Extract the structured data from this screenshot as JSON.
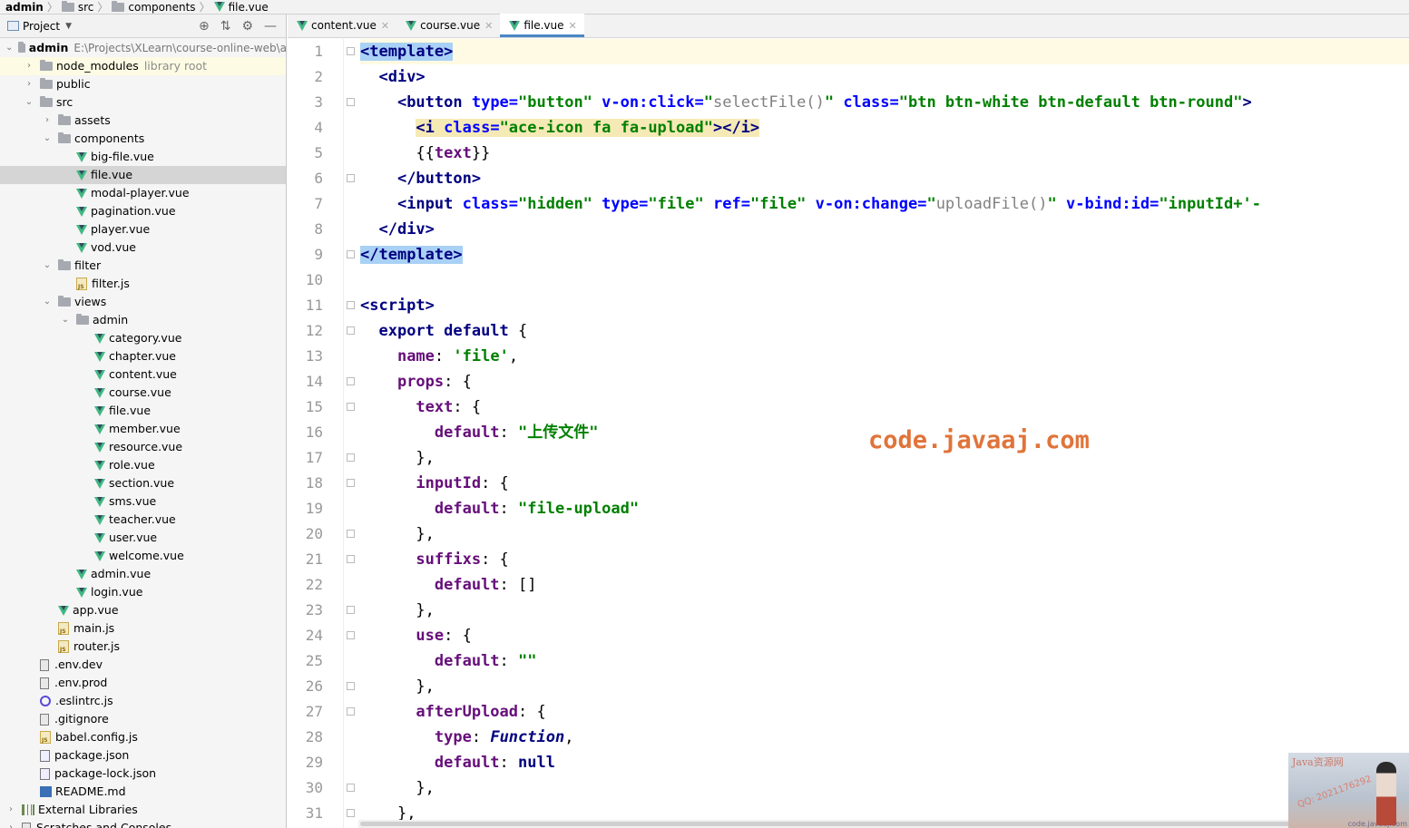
{
  "breadcrumb": [
    "admin",
    "src",
    "components",
    "file.vue"
  ],
  "project_panel": {
    "title": "Project",
    "tree": [
      {
        "label": "admin",
        "path": "E:\\Projects\\XLearn\\course-online-web\\a",
        "type": "folder",
        "depth": 0,
        "open": true,
        "bold": true
      },
      {
        "label": "node_modules",
        "extra": "library root",
        "type": "folder",
        "depth": 1,
        "open": false,
        "highlight": true
      },
      {
        "label": "public",
        "type": "folder",
        "depth": 1,
        "open": false
      },
      {
        "label": "src",
        "type": "folder",
        "depth": 1,
        "open": true
      },
      {
        "label": "assets",
        "type": "folder",
        "depth": 2,
        "open": false
      },
      {
        "label": "components",
        "type": "folder",
        "depth": 2,
        "open": true
      },
      {
        "label": "big-file.vue",
        "type": "vue",
        "depth": 3
      },
      {
        "label": "file.vue",
        "type": "vue",
        "depth": 3,
        "selected": true
      },
      {
        "label": "modal-player.vue",
        "type": "vue",
        "depth": 3
      },
      {
        "label": "pagination.vue",
        "type": "vue",
        "depth": 3
      },
      {
        "label": "player.vue",
        "type": "vue",
        "depth": 3
      },
      {
        "label": "vod.vue",
        "type": "vue",
        "depth": 3
      },
      {
        "label": "filter",
        "type": "folder",
        "depth": 2,
        "open": true
      },
      {
        "label": "filter.js",
        "type": "js",
        "depth": 3
      },
      {
        "label": "views",
        "type": "folder",
        "depth": 2,
        "open": true
      },
      {
        "label": "admin",
        "type": "folder",
        "depth": 3,
        "open": true
      },
      {
        "label": "category.vue",
        "type": "vue",
        "depth": 4
      },
      {
        "label": "chapter.vue",
        "type": "vue",
        "depth": 4
      },
      {
        "label": "content.vue",
        "type": "vue",
        "depth": 4
      },
      {
        "label": "course.vue",
        "type": "vue",
        "depth": 4
      },
      {
        "label": "file.vue",
        "type": "vue",
        "depth": 4
      },
      {
        "label": "member.vue",
        "type": "vue",
        "depth": 4
      },
      {
        "label": "resource.vue",
        "type": "vue",
        "depth": 4
      },
      {
        "label": "role.vue",
        "type": "vue",
        "depth": 4
      },
      {
        "label": "section.vue",
        "type": "vue",
        "depth": 4
      },
      {
        "label": "sms.vue",
        "type": "vue",
        "depth": 4
      },
      {
        "label": "teacher.vue",
        "type": "vue",
        "depth": 4
      },
      {
        "label": "user.vue",
        "type": "vue",
        "depth": 4
      },
      {
        "label": "welcome.vue",
        "type": "vue",
        "depth": 4
      },
      {
        "label": "admin.vue",
        "type": "vue",
        "depth": 3
      },
      {
        "label": "login.vue",
        "type": "vue",
        "depth": 3
      },
      {
        "label": "app.vue",
        "type": "vue",
        "depth": 2
      },
      {
        "label": "main.js",
        "type": "js",
        "depth": 2
      },
      {
        "label": "router.js",
        "type": "js",
        "depth": 2
      },
      {
        "label": ".env.dev",
        "type": "file",
        "depth": 1
      },
      {
        "label": ".env.prod",
        "type": "file",
        "depth": 1
      },
      {
        "label": ".eslintrc.js",
        "type": "eslint",
        "depth": 1
      },
      {
        "label": ".gitignore",
        "type": "file",
        "depth": 1
      },
      {
        "label": "babel.config.js",
        "type": "js",
        "depth": 1
      },
      {
        "label": "package.json",
        "type": "json",
        "depth": 1
      },
      {
        "label": "package-lock.json",
        "type": "json",
        "depth": 1
      },
      {
        "label": "README.md",
        "type": "md",
        "depth": 1
      },
      {
        "label": "External Libraries",
        "type": "lib",
        "depth": 0,
        "open": false
      },
      {
        "label": "Scratches and Consoles",
        "type": "scratch",
        "depth": 0,
        "open": false
      }
    ]
  },
  "tabs": [
    {
      "label": "content.vue",
      "active": false
    },
    {
      "label": "course.vue",
      "active": false
    },
    {
      "label": "file.vue",
      "active": true
    }
  ],
  "code_lines": [
    [
      [
        "<",
        "tag tpl-hl"
      ],
      [
        "template",
        "tag tpl-hl"
      ],
      [
        ">",
        "tag tpl-hl"
      ]
    ],
    [
      [
        "  ",
        ""
      ],
      [
        "<div>",
        "tag"
      ]
    ],
    [
      [
        "    ",
        ""
      ],
      [
        "<button ",
        "tag"
      ],
      [
        "type=",
        "attr"
      ],
      [
        "\"button\"",
        "str"
      ],
      [
        " v-on:click=",
        "attr"
      ],
      [
        "\"",
        "str"
      ],
      [
        "selectFile()",
        "fn"
      ],
      [
        "\"",
        "str"
      ],
      [
        " class=",
        "attr"
      ],
      [
        "\"btn btn-white btn-default btn-round\"",
        "str"
      ],
      [
        ">",
        "tag"
      ]
    ],
    [
      [
        "      ",
        ""
      ],
      [
        "<i ",
        "tag i-hl"
      ],
      [
        "class=",
        "attr i-hl"
      ],
      [
        "\"ace-icon fa fa-upload\"",
        "str i-hl"
      ],
      [
        "></i>",
        "tag i-hl"
      ]
    ],
    [
      [
        "      ",
        ""
      ],
      [
        "{{",
        ""
      ],
      [
        "text",
        "prop"
      ],
      [
        "}}",
        ""
      ]
    ],
    [
      [
        "    ",
        ""
      ],
      [
        "</button>",
        "tag"
      ]
    ],
    [
      [
        "    ",
        ""
      ],
      [
        "<input ",
        "tag"
      ],
      [
        "class=",
        "attr"
      ],
      [
        "\"hidden\"",
        "str"
      ],
      [
        " type=",
        "attr"
      ],
      [
        "\"file\"",
        "str"
      ],
      [
        " ref=",
        "attr"
      ],
      [
        "\"file\"",
        "str"
      ],
      [
        " v-on:change=",
        "attr"
      ],
      [
        "\"",
        "str"
      ],
      [
        "uploadFile()",
        "fn"
      ],
      [
        "\"",
        "str"
      ],
      [
        " v-bind:id=",
        "attr"
      ],
      [
        "\"inputId+'-",
        "str"
      ]
    ],
    [
      [
        "  ",
        ""
      ],
      [
        "</div>",
        "tag"
      ]
    ],
    [
      [
        "</",
        "tag tpl-hl"
      ],
      [
        "template",
        "tag tpl-hl"
      ],
      [
        ">",
        "tag tpl-hl"
      ]
    ],
    [
      [
        "",
        ""
      ]
    ],
    [
      [
        "<script>",
        "tag"
      ]
    ],
    [
      [
        "  ",
        ""
      ],
      [
        "export default",
        "kw"
      ],
      [
        " {",
        ""
      ]
    ],
    [
      [
        "    ",
        ""
      ],
      [
        "name",
        "prop"
      ],
      [
        ": ",
        ""
      ],
      [
        "'file'",
        "str"
      ],
      [
        ",",
        ""
      ]
    ],
    [
      [
        "    ",
        ""
      ],
      [
        "props",
        "prop"
      ],
      [
        ": {",
        ""
      ]
    ],
    [
      [
        "      ",
        ""
      ],
      [
        "text",
        "prop"
      ],
      [
        ": {",
        ""
      ]
    ],
    [
      [
        "        ",
        ""
      ],
      [
        "default",
        "prop"
      ],
      [
        ": ",
        ""
      ],
      [
        "\"上传文件\"",
        "str"
      ]
    ],
    [
      [
        "      ",
        ""
      ],
      [
        "},",
        ""
      ]
    ],
    [
      [
        "      ",
        ""
      ],
      [
        "inputId",
        "prop"
      ],
      [
        ": {",
        ""
      ]
    ],
    [
      [
        "        ",
        ""
      ],
      [
        "default",
        "prop"
      ],
      [
        ": ",
        ""
      ],
      [
        "\"file-upload\"",
        "str"
      ]
    ],
    [
      [
        "      ",
        ""
      ],
      [
        "},",
        ""
      ]
    ],
    [
      [
        "      ",
        ""
      ],
      [
        "suffixs",
        "prop"
      ],
      [
        ": {",
        ""
      ]
    ],
    [
      [
        "        ",
        ""
      ],
      [
        "default",
        "prop"
      ],
      [
        ": []",
        ""
      ]
    ],
    [
      [
        "      ",
        ""
      ],
      [
        "},",
        ""
      ]
    ],
    [
      [
        "      ",
        ""
      ],
      [
        "use",
        "prop"
      ],
      [
        ": {",
        ""
      ]
    ],
    [
      [
        "        ",
        ""
      ],
      [
        "default",
        "prop"
      ],
      [
        ": ",
        ""
      ],
      [
        "\"\"",
        "str"
      ]
    ],
    [
      [
        "      ",
        ""
      ],
      [
        "},",
        ""
      ]
    ],
    [
      [
        "      ",
        ""
      ],
      [
        "afterUpload",
        "prop"
      ],
      [
        ": {",
        ""
      ]
    ],
    [
      [
        "        ",
        ""
      ],
      [
        "type",
        "prop"
      ],
      [
        ": ",
        ""
      ],
      [
        "Function",
        "ital"
      ],
      [
        ",",
        ""
      ]
    ],
    [
      [
        "        ",
        ""
      ],
      [
        "default",
        "prop"
      ],
      [
        ": ",
        ""
      ],
      [
        "null",
        "kw"
      ]
    ],
    [
      [
        "      ",
        ""
      ],
      [
        "},",
        ""
      ]
    ],
    [
      [
        "    ",
        ""
      ],
      [
        "},",
        ""
      ]
    ]
  ],
  "line_numbers": [
    "1",
    "2",
    "3",
    "4",
    "5",
    "6",
    "7",
    "8",
    "9",
    "10",
    "11",
    "12",
    "13",
    "14",
    "15",
    "16",
    "17",
    "18",
    "19",
    "20",
    "21",
    "22",
    "23",
    "24",
    "25",
    "26",
    "27",
    "28",
    "29",
    "30",
    "31"
  ],
  "watermark": "code.javaaj.com",
  "corner_stamp": {
    "title": "Java资源网",
    "qq": "QQ: 2021176292",
    "site": "code.javaaj.com"
  }
}
